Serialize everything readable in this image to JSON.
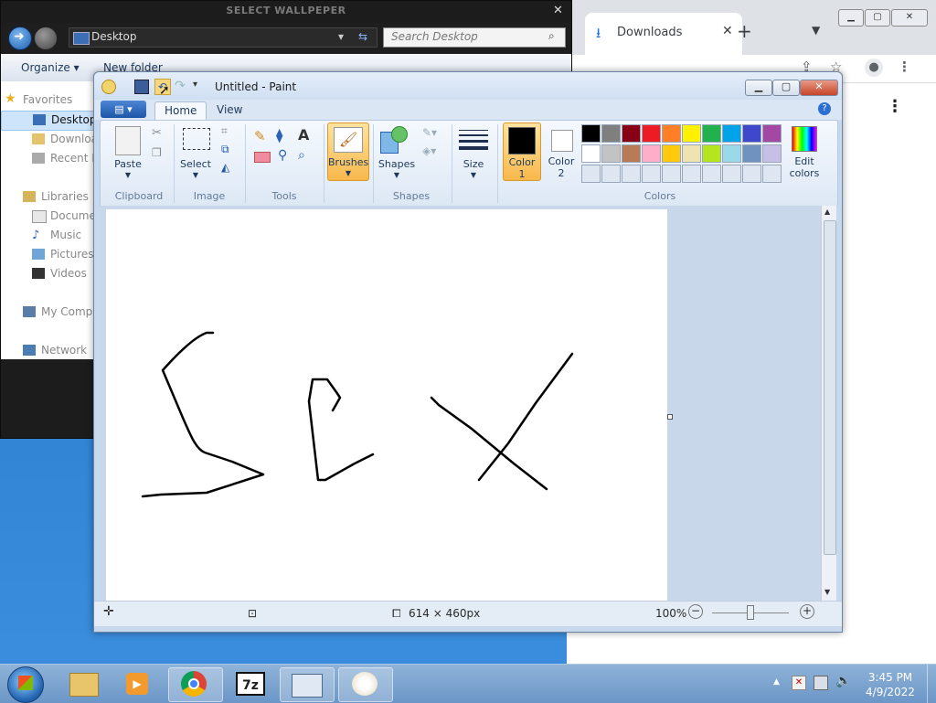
{
  "chrome": {
    "tab_title": "Downloads",
    "tab_icon": "download-icon",
    "new_tab": "+",
    "tab_close": "✕",
    "minimize": "▁",
    "maximize": "▢",
    "close": "✕"
  },
  "explorer": {
    "title": "SELECT WALLPEPER",
    "address": "Desktop",
    "search_placeholder": "Search Desktop",
    "organize": "Organize ▾",
    "new_folder": "New folder",
    "nav": {
      "favorites": "Favorites",
      "desktop": "Desktop",
      "downloads": "Downloa",
      "recent": "Recent P",
      "libraries": "Libraries",
      "documents": "Documen",
      "music": "Music",
      "pictures": "Pictures",
      "videos": "Videos",
      "computer": "My Compu",
      "network": "Network"
    }
  },
  "paint": {
    "title": "Untitled - Paint",
    "tabs": {
      "home": "Home",
      "view": "View"
    },
    "groups": {
      "clipboard": "Clipboard",
      "image": "Image",
      "tools": "Tools",
      "shapes": "Shapes",
      "colors": "Colors"
    },
    "buttons": {
      "paste": "Paste",
      "select": "Select",
      "brushes": "Brushes",
      "shapes": "Shapes",
      "size": "Size",
      "color1_a": "Color",
      "color1_b": "1",
      "color2_a": "Color",
      "color2_b": "2",
      "edit_a": "Edit",
      "edit_b": "colors"
    },
    "palette_row1": [
      "#000000",
      "#7f7f7f",
      "#880015",
      "#ed1c24",
      "#ff7f27",
      "#fff200",
      "#22b14c",
      "#00a2e8",
      "#3f48cc",
      "#a349a4"
    ],
    "palette_row2": [
      "#ffffff",
      "#c3c3c3",
      "#b97a57",
      "#ffaec9",
      "#ffc90e",
      "#efe4b0",
      "#b5e61d",
      "#99d9ea",
      "#7092be",
      "#c8bfe7"
    ],
    "status": {
      "size": "614 × 460px",
      "zoom": "100%"
    }
  },
  "taskbar": {
    "time": "3:45 PM",
    "date": "4/9/2022"
  }
}
